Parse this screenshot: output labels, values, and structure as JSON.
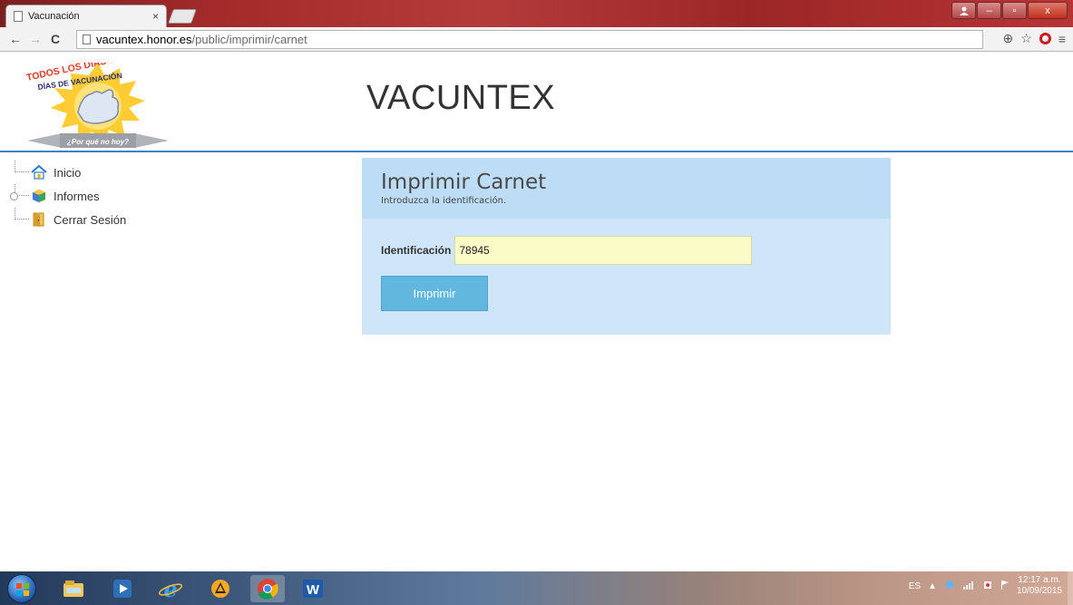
{
  "browser": {
    "tab_title": "Vacunación",
    "tab_close": "×",
    "url_host": "vacuntex.honor.es",
    "url_path": "/public/imprimir/carnet",
    "back": "←",
    "forward": "→",
    "reload": "C",
    "zoom": "⊕",
    "star": "☆",
    "menu": "≡",
    "minimize": "–",
    "maximize": "▫",
    "close": "x"
  },
  "logo": {
    "line1": "TODOS LOS DÍAS SON",
    "line2": "DÍAS DE VACUNACIÓN",
    "banner": "¿Por qué no hoy?"
  },
  "site": {
    "title": "VACUNTEX"
  },
  "nav": {
    "items": [
      {
        "label": "Inicio",
        "icon": "home-icon"
      },
      {
        "label": "Informes",
        "icon": "cube-icon"
      },
      {
        "label": "Cerrar Sesión",
        "icon": "door-icon"
      }
    ]
  },
  "form": {
    "title": "Imprimir Carnet",
    "subtitle": "Introduzca la identificación.",
    "id_label": "Identificación",
    "id_value": "78945",
    "submit_label": "Imprimir"
  },
  "taskbar": {
    "lang": "ES",
    "time": "12:17 a.m.",
    "date": "10/09/2015"
  }
}
